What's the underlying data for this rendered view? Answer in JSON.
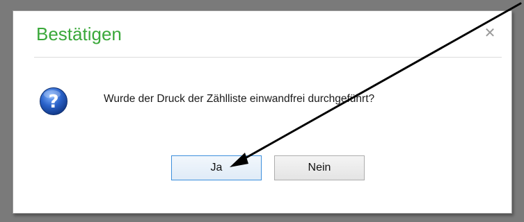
{
  "dialog": {
    "title": "Bestätigen",
    "close_glyph": "✕",
    "icon": "question-icon",
    "message": "Wurde der Druck der Zählliste einwandfrei durchgeführt?",
    "buttons": {
      "yes_label": "Ja",
      "no_label": "Nein"
    }
  },
  "colors": {
    "title": "#3aa83a",
    "accent_button_border": "#3c8fdc",
    "annotation_arrow": "#000000"
  },
  "annotation": {
    "icon": "arrow-icon",
    "target": "yes-button"
  }
}
